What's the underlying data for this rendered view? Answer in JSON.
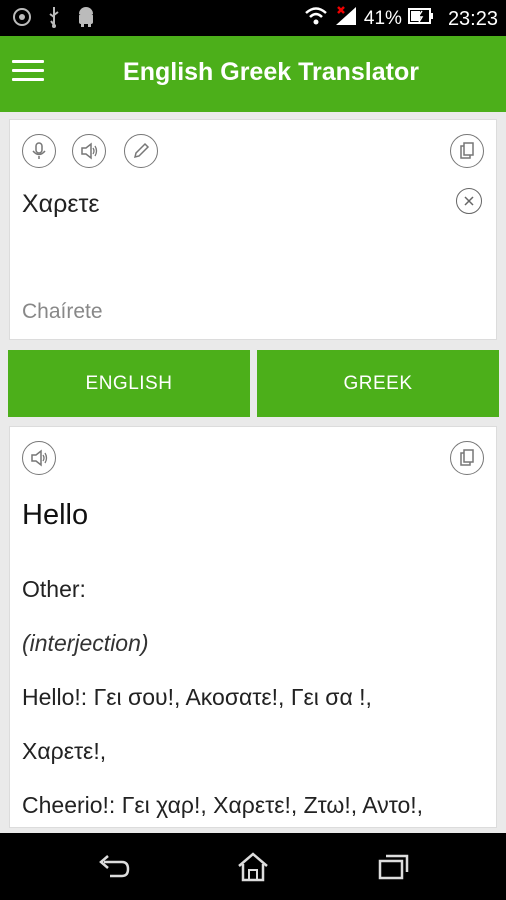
{
  "status": {
    "battery": "41%",
    "time": "23:23"
  },
  "appbar": {
    "title": "English Greek Translator"
  },
  "input": {
    "text": "Χαρετε",
    "transliteration": "Chaírete"
  },
  "languages": {
    "source": "ENGLISH",
    "target": "GREEK"
  },
  "output": {
    "main": "Hello",
    "lines": [
      {
        "text": "Other:",
        "italic": false
      },
      {
        "text": "(interjection)",
        "italic": true
      },
      {
        "text": "Hello!: Γει σου!, Ακοσατε!, Γει σα   !,",
        "italic": false
      },
      {
        "text": "Χαρετε!,",
        "italic": false
      },
      {
        "text": "Cheerio!: Γει χαρ!, Χαρετε!, Ζτω!, Αντο!,",
        "italic": false
      }
    ]
  },
  "colors": {
    "accent": "#4caf1a"
  },
  "icons": [
    "microphone-icon",
    "speaker-icon",
    "pencil-icon",
    "copy-icon",
    "clear-icon",
    "back-icon",
    "home-icon",
    "recents-icon"
  ]
}
